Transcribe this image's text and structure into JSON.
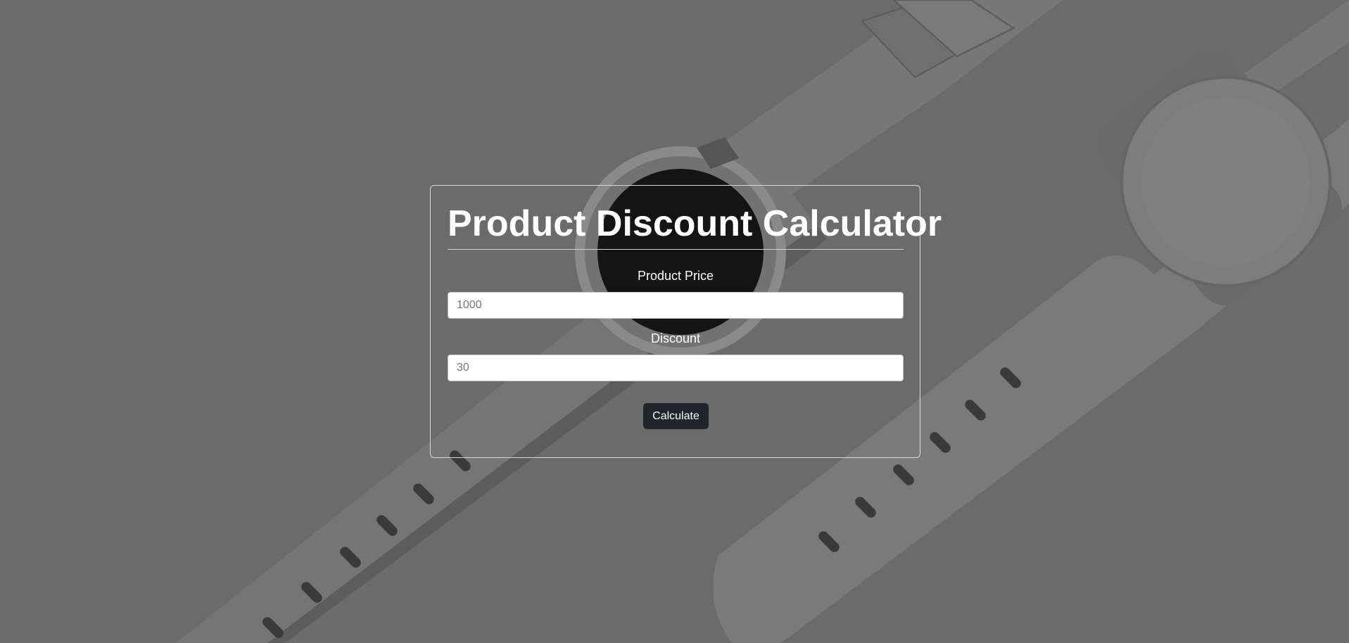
{
  "theme": {
    "background": "#6d6d6d",
    "button_bg": "#212529",
    "text": "#ffffff"
  },
  "calculator": {
    "title": "Product Discount Calculator",
    "price": {
      "label": "Product Price",
      "placeholder": "1000",
      "value": ""
    },
    "discount": {
      "label": "Discount",
      "placeholder": "30",
      "value": ""
    },
    "calculate_label": "Calculate"
  }
}
